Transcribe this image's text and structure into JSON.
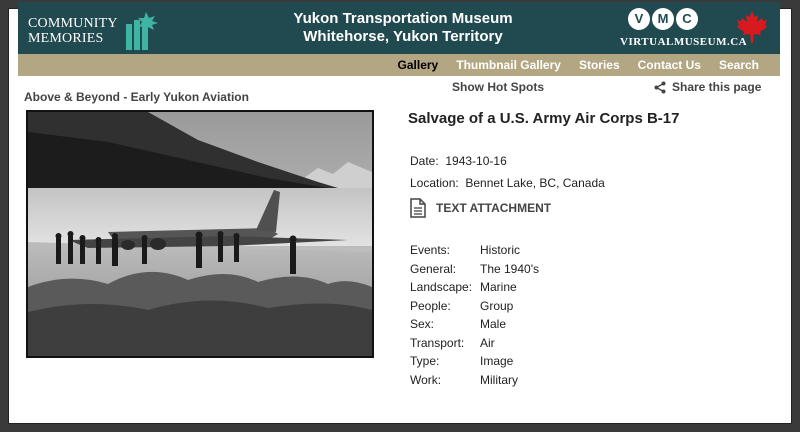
{
  "header": {
    "logo_line1": "COMMUNITY",
    "logo_line2": "MEMORIES",
    "title_line1": "Yukon Transportation Museum",
    "title_line2": "Whitehorse, Yukon Territory",
    "vmc_letters": [
      "V",
      "M",
      "C"
    ],
    "vmc_url": "VIRTUALMUSEUM.CA",
    "bg_color": "#214950"
  },
  "nav": {
    "bg_color": "#b2a683",
    "items": [
      {
        "label": "Gallery",
        "active": true
      },
      {
        "label": "Thumbnail Gallery",
        "active": false
      },
      {
        "label": "Stories",
        "active": false
      },
      {
        "label": "Contact Us",
        "active": false
      },
      {
        "label": "Search",
        "active": false
      }
    ]
  },
  "gallery": {
    "section_title": "Above & Beyond - Early Yukon Aviation",
    "hotspots_label": "Show Hot Spots",
    "share_label": "Share this page"
  },
  "record": {
    "title": "Salvage of a U.S. Army Air Corps B-17",
    "date_label": "Date:",
    "date_value": "1943-10-16",
    "location_label": "Location:",
    "location_value": "Bennet Lake, BC, Canada",
    "attachment_label": "TEXT ATTACHMENT",
    "tags": [
      {
        "key": "Events:",
        "value": "Historic"
      },
      {
        "key": "General:",
        "value": "The 1940's"
      },
      {
        "key": "Landscape:",
        "value": "Marine"
      },
      {
        "key": "People:",
        "value": "Group"
      },
      {
        "key": "Sex:",
        "value": "Male"
      },
      {
        "key": "Transport:",
        "value": "Air"
      },
      {
        "key": "Type:",
        "value": "Image"
      },
      {
        "key": "Work:",
        "value": "Military"
      }
    ]
  }
}
